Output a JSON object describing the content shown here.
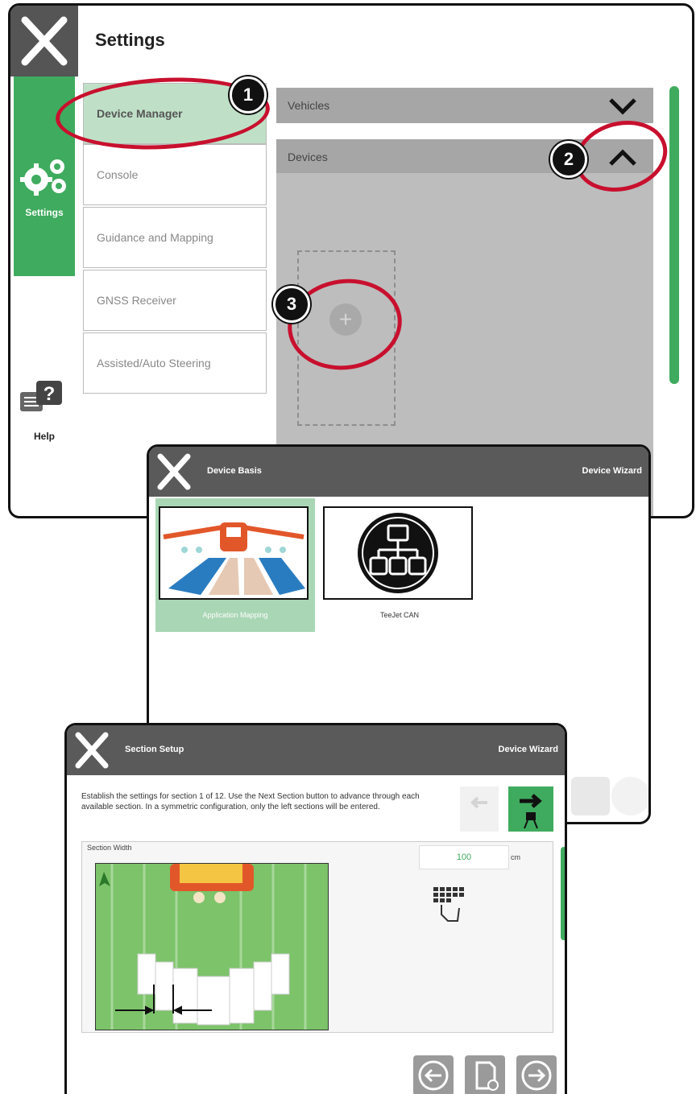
{
  "screen1": {
    "title": "Settings",
    "sidebar_tab_label": "Settings",
    "help_label": "Help",
    "menu_items": [
      {
        "label": "Device Manager"
      },
      {
        "label": "Console"
      },
      {
        "label": "Guidance and Mapping"
      },
      {
        "label": "GNSS Receiver"
      },
      {
        "label": "Assisted/Auto Steering"
      }
    ],
    "sections": [
      {
        "label": "Vehicles",
        "state": "collapsed"
      },
      {
        "label": "Devices",
        "state": "expanded"
      }
    ],
    "callouts": [
      "1",
      "2",
      "3"
    ],
    "colors": {
      "accent": "#3fab5e",
      "callout": "#c8102e",
      "bar": "#555555"
    }
  },
  "screen2": {
    "title": "Device Basis",
    "right_title": "Device Wizard",
    "tiles": [
      {
        "label": "Application Mapping",
        "icon": "sprayer-icon",
        "selected": true
      },
      {
        "label": "TeeJet CAN",
        "icon": "can-network-icon",
        "selected": false
      }
    ]
  },
  "screen3": {
    "title": "Section Setup",
    "right_title": "Device Wizard",
    "description": "Establish the settings for section 1 of 12. Use the Next Section button to advance through each available section. In a symmetric configuration, only the left sections will be entered.",
    "section_width_label": "Section Width",
    "section_width_value": "100",
    "unit": "cm",
    "icons": [
      "previous-section-icon",
      "next-section-icon",
      "keypad-icon",
      "back-icon",
      "save-icon",
      "forward-icon"
    ]
  }
}
